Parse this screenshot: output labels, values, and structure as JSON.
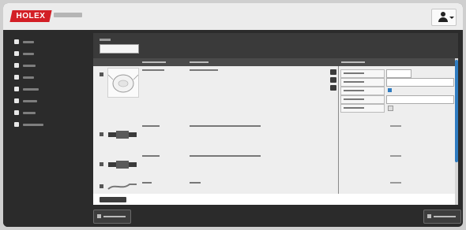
{
  "header": {
    "logo_text": "HOLEX",
    "user_icon": "user-icon",
    "dropdown_icon": "caret-down-icon"
  },
  "sidebar": {
    "items": [
      {
        "icon": "home-icon"
      },
      {
        "icon": "list-icon"
      },
      {
        "icon": "user-icon"
      },
      {
        "icon": "refresh-icon"
      },
      {
        "icon": "box-icon"
      },
      {
        "icon": "key-icon"
      },
      {
        "icon": "wrench-icon"
      },
      {
        "icon": "tools-icon"
      }
    ]
  },
  "colors": {
    "brand_red": "#d31f26",
    "accent_blue": "#2f7cc1",
    "dark_bg": "#2b2b2b"
  }
}
